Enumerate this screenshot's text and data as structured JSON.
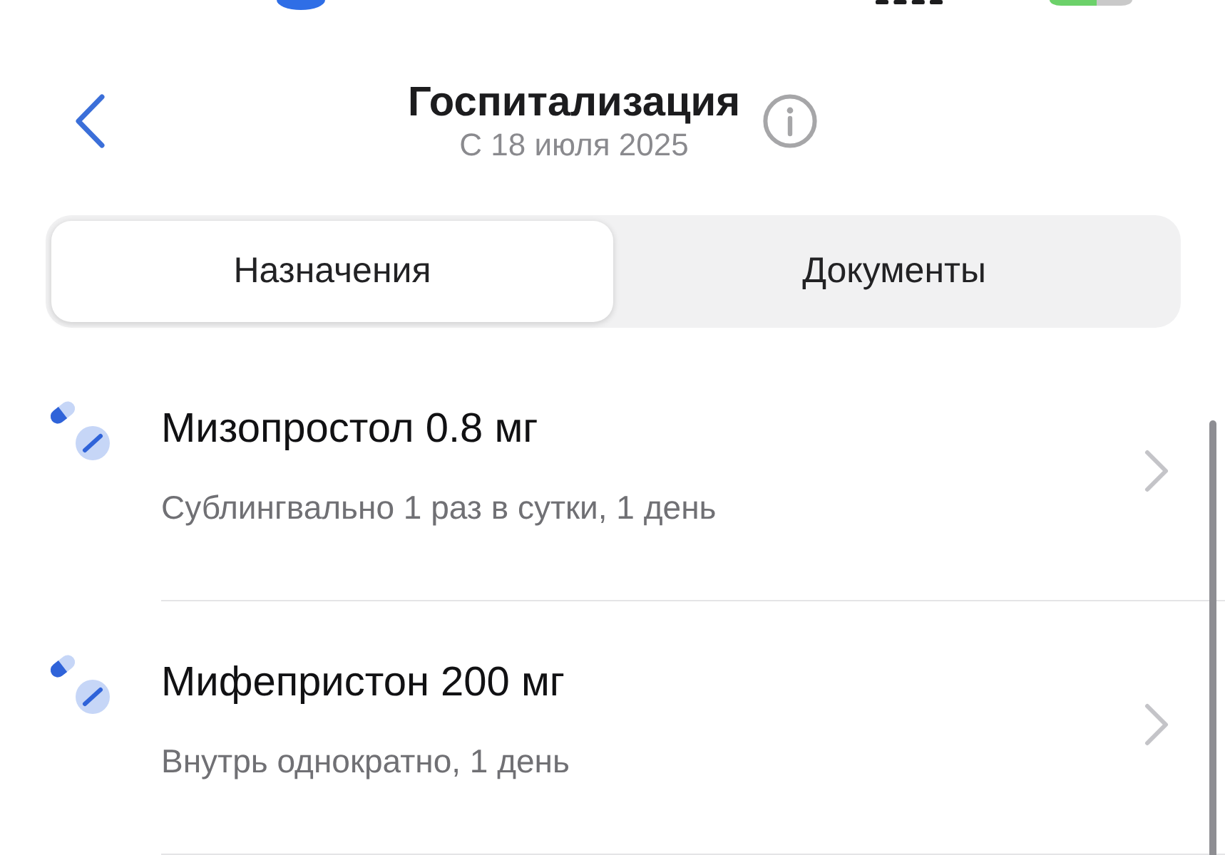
{
  "header": {
    "title": "Госпитализация",
    "subtitle": "С 18 июля 2025"
  },
  "tabs": [
    {
      "label": "Назначения",
      "selected": true
    },
    {
      "label": "Документы",
      "selected": false
    }
  ],
  "prescriptions": [
    {
      "name": "Мизопростол 0.8 мг",
      "instructions": "Сублингвально 1 раз в сутки, 1 день"
    },
    {
      "name": "Мифепристон 200 мг",
      "instructions": "Внутрь однократно, 1 день"
    }
  ]
}
